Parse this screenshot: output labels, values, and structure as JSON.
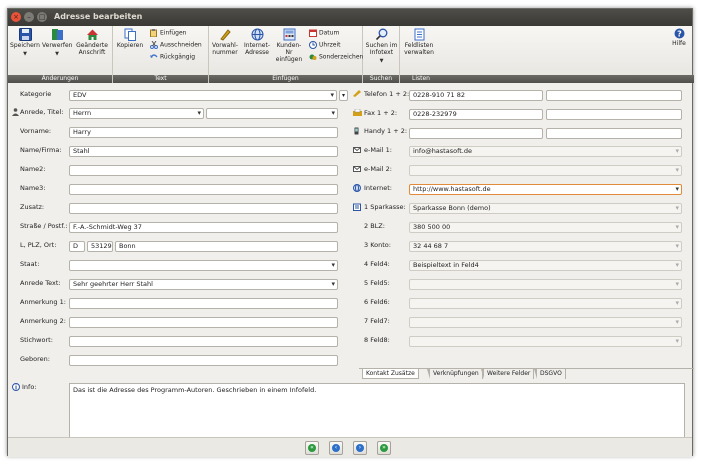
{
  "window": {
    "title": "Adresse bearbeiten"
  },
  "toolbar": {
    "groups": {
      "aenderungen": "Änderungen",
      "text": "Text",
      "einfuegen": "Einfügen",
      "suchen": "Suchen",
      "listen": "Listen"
    },
    "speichern": "Speichern",
    "verwerfen": "Verwerfen",
    "geaenderte": "Geänderte",
    "anschrift": "Anschrift",
    "kopieren": "Kopieren",
    "einfuegen_btn": "Einfügen",
    "ausschneiden": "Ausschneiden",
    "rueckgaengig": "Rückgängig",
    "vorwahl1": "Vorwahl-",
    "vorwahl2": "nummer",
    "internet1": "Internet-",
    "internet2": "Adresse",
    "kunden1": "Kunden-Nr",
    "kunden2": "einfügen",
    "datum": "Datum",
    "uhrzeit": "Uhrzeit",
    "sonderzeichen": "Sonderzeichen",
    "suchen1": "Suchen im",
    "suchen2": "Infotext",
    "feldlisten1": "Feldlisten",
    "feldlisten2": "verwalten",
    "hilfe": "Hilfe"
  },
  "labels": {
    "kategorie": "Kategorie",
    "anrede_titel": "Anrede, Titel:",
    "vorname": "Vorname:",
    "name_firma": "Name/Firma:",
    "name2": "Name2:",
    "name3": "Name3:",
    "zusatz": "Zusatz:",
    "strasse": "Straße / Postf.:",
    "lplz": "L, PLZ, Ort:",
    "staat": "Staat:",
    "anrede_text": "Anrede Text:",
    "anmerkung1": "Anmerkung 1:",
    "anmerkung2": "Anmerkung 2:",
    "stichwort": "Stichwort:",
    "geboren": "Geboren:",
    "telefon": "Telefon 1 + 2:",
    "fax": "Fax 1 + 2:",
    "handy": "Handy 1 + 2:",
    "email1": "e-Mail 1:",
    "email2": "e-Mail 2:",
    "internet": "Internet:",
    "sparkasse": "1 Sparkasse:",
    "blz": "2 BLZ:",
    "konto": "3 Konto:",
    "feld4": "4 Feld4:",
    "feld5": "5 Feld5:",
    "feld6": "6 Feld6:",
    "feld7": "7 Feld7:",
    "feld8": "8 Feld8:",
    "info": "Info:"
  },
  "values": {
    "kategorie": "EDV",
    "anrede": "Herrn",
    "titel": "",
    "vorname": "Harry",
    "name_firma": "Stahl",
    "name2": "",
    "name3": "",
    "zusatz": "",
    "strasse": "F.-A.-Schmidt-Weg 37",
    "land": "D",
    "plz": "53129",
    "ort": "Bonn",
    "staat": "",
    "anrede_text": "Sehr geehrter Herr Stahl",
    "anmerkung1": "",
    "anmerkung2": "",
    "stichwort": "",
    "geboren": "",
    "telefon1": "0228-910 71 82",
    "telefon2": "",
    "fax1": "0228-232979",
    "fax2": "",
    "handy1": "",
    "handy2": "",
    "email1": "info@hastasoft.de",
    "email2": "",
    "internet": "http://www.hastasoft.de",
    "sparkasse": "Sparkasse Bonn (demo)",
    "blz": "380 500 00",
    "konto": "32 44 68 7",
    "feld4": "Beispieltext in Feld4",
    "feld5": "",
    "feld6": "",
    "feld7": "",
    "feld8": "",
    "info": "Das ist die Adresse des Programm-Autoren. Geschrieben in einem Infofeld."
  },
  "tabs": [
    {
      "label": "Kontakt Zusätze"
    },
    {
      "label": "Verknüpfungen"
    },
    {
      "label": "Weitere Felder"
    },
    {
      "label": "DSGVO"
    }
  ],
  "colors": {
    "accent": "#e08a3a",
    "titlebar": "#3c3b37",
    "groupbar": "#5a5955"
  }
}
